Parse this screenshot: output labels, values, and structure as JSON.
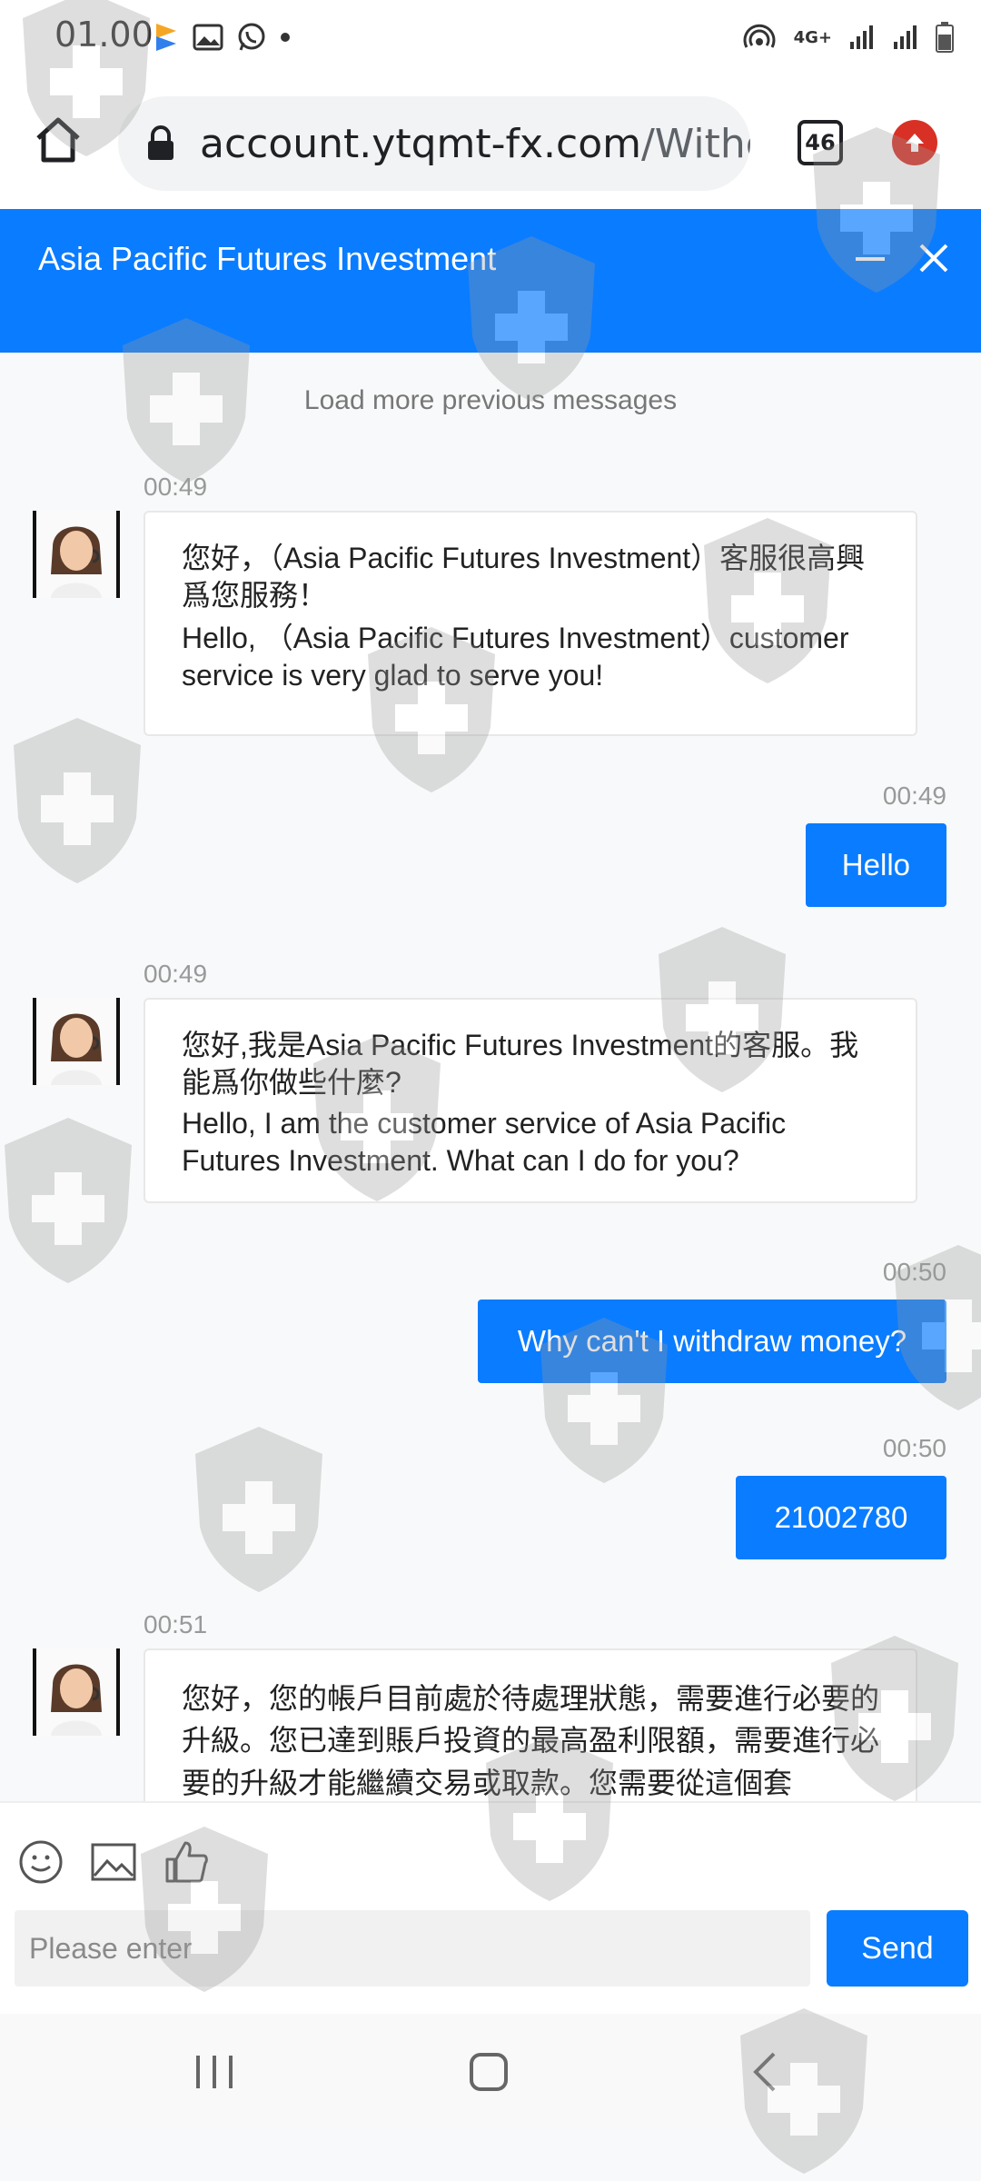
{
  "status_bar": {
    "time": "01.00",
    "network": "4G+"
  },
  "browser": {
    "url_host": "account.ytqmt-fx.com",
    "url_path": "/Withd",
    "tab_count": "46"
  },
  "chat": {
    "title": "Asia Pacific Futures Investment",
    "load_more": "Load more previous messages",
    "messages": [
      {
        "from": "agent",
        "time": "00:49",
        "zh": "您好，（Asia Pacific Futures Investment）客服很高興爲您服務！",
        "en": "Hello, （Asia Pacific Futures Investment）customer service is very glad to serve you!"
      },
      {
        "from": "user",
        "time": "00:49",
        "text": "Hello"
      },
      {
        "from": "agent",
        "time": "00:49",
        "zh": "您好,我是Asia Pacific Futures Investment的客服。我能爲你做些什麼?",
        "en": "Hello, I am the customer service of Asia Pacific Futures Investment. What can I do for you?"
      },
      {
        "from": "user",
        "time": "00:50",
        "text": "Why can't I withdraw money?"
      },
      {
        "from": "user",
        "time": "00:50",
        "text": "21002780"
      },
      {
        "from": "agent",
        "time": "00:51",
        "zh": "您好，您的帳戶目前處於待處理狀態，需要進行必要的升級。您已達到賬戶投資的最高盈利限額，需要進行必要的升級才能繼續交易或取款。您需要從這個套"
      }
    ]
  },
  "input": {
    "placeholder": "Please enter",
    "send_label": "Send"
  },
  "colors": {
    "accent": "#0a7cff",
    "background": "#f8f9fa"
  }
}
